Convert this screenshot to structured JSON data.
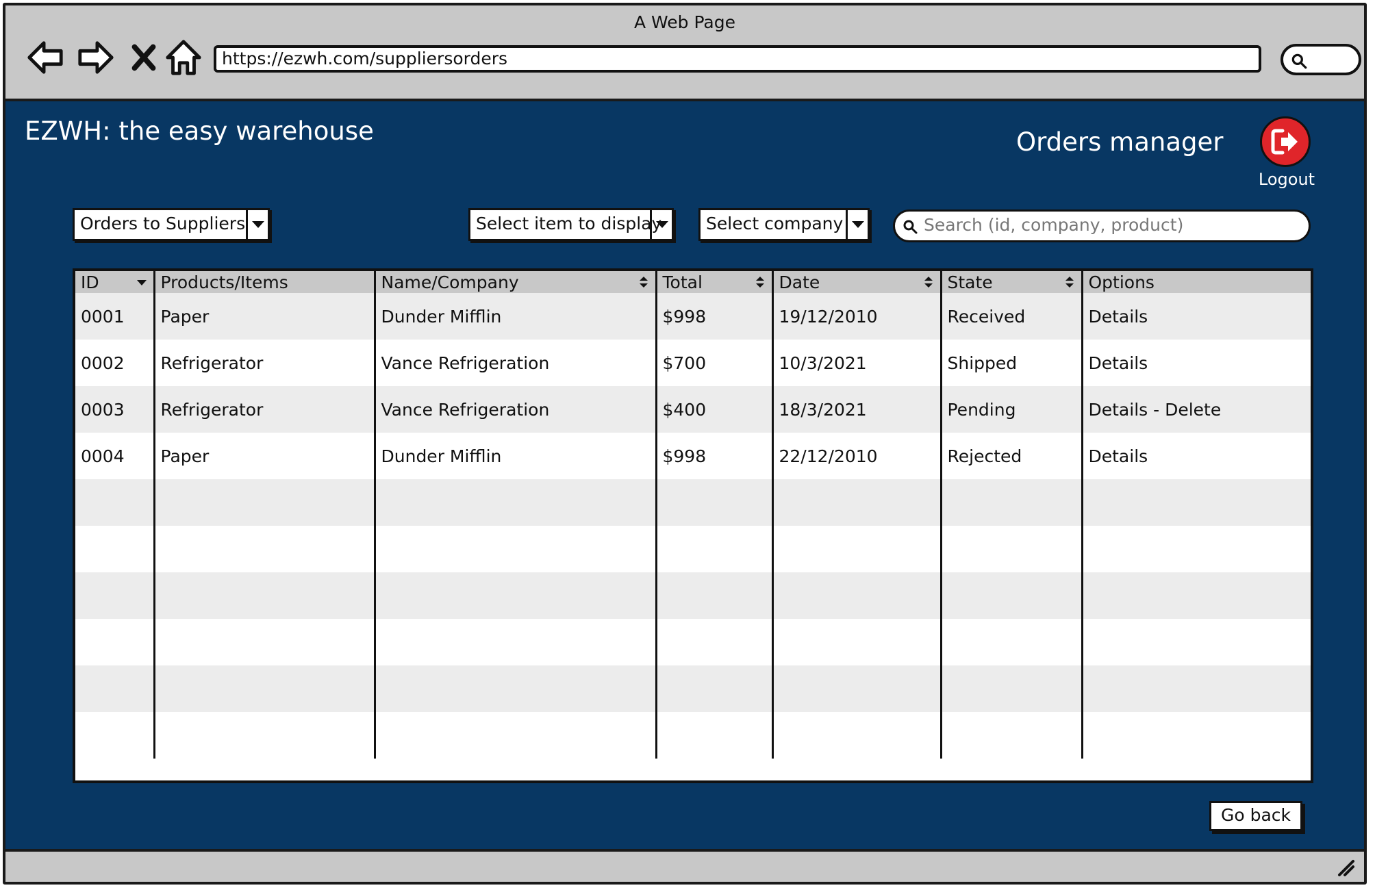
{
  "window": {
    "title": "A Web Page"
  },
  "browser": {
    "url": "https://ezwh.com/suppliersorders"
  },
  "app": {
    "title": "EZWH: the easy warehouse",
    "page_heading": "Orders manager",
    "logout_label": "Logout"
  },
  "filters": {
    "orders_type": "Orders to Suppliers",
    "item_select": "Select item to display",
    "company_select": "Select company",
    "search_placeholder": "Search (id, company, product)"
  },
  "table": {
    "headers": [
      "ID",
      "Products/Items",
      "Name/Company",
      "Total",
      "Date",
      "State",
      "Options"
    ],
    "rows": [
      [
        "0001",
        "Paper",
        "Dunder Mifflin",
        "$998",
        "19/12/2010",
        "Received",
        "Details"
      ],
      [
        "0002",
        "Refrigerator",
        "Vance Refrigeration",
        "$700",
        "10/3/2021",
        "Shipped",
        "Details"
      ],
      [
        "0003",
        "Refrigerator",
        "Vance Refrigeration",
        "$400",
        "18/3/2021",
        "Pending",
        "Details - Delete"
      ],
      [
        "0004",
        "Paper",
        "Dunder Mifflin",
        "$998",
        "22/12/2010",
        "Rejected",
        "Details"
      ],
      [
        "",
        "",
        "",
        "",
        "",
        "",
        ""
      ],
      [
        "",
        "",
        "",
        "",
        "",
        "",
        ""
      ],
      [
        "",
        "",
        "",
        "",
        "",
        "",
        ""
      ],
      [
        "",
        "",
        "",
        "",
        "",
        "",
        ""
      ],
      [
        "",
        "",
        "",
        "",
        "",
        "",
        ""
      ],
      [
        "",
        "",
        "",
        "",
        "",
        "",
        ""
      ]
    ]
  },
  "actions": {
    "go_back": "Go back"
  },
  "colors": {
    "background": "#083763",
    "logout": "#e0252a",
    "chrome": "#c8c8c8"
  }
}
